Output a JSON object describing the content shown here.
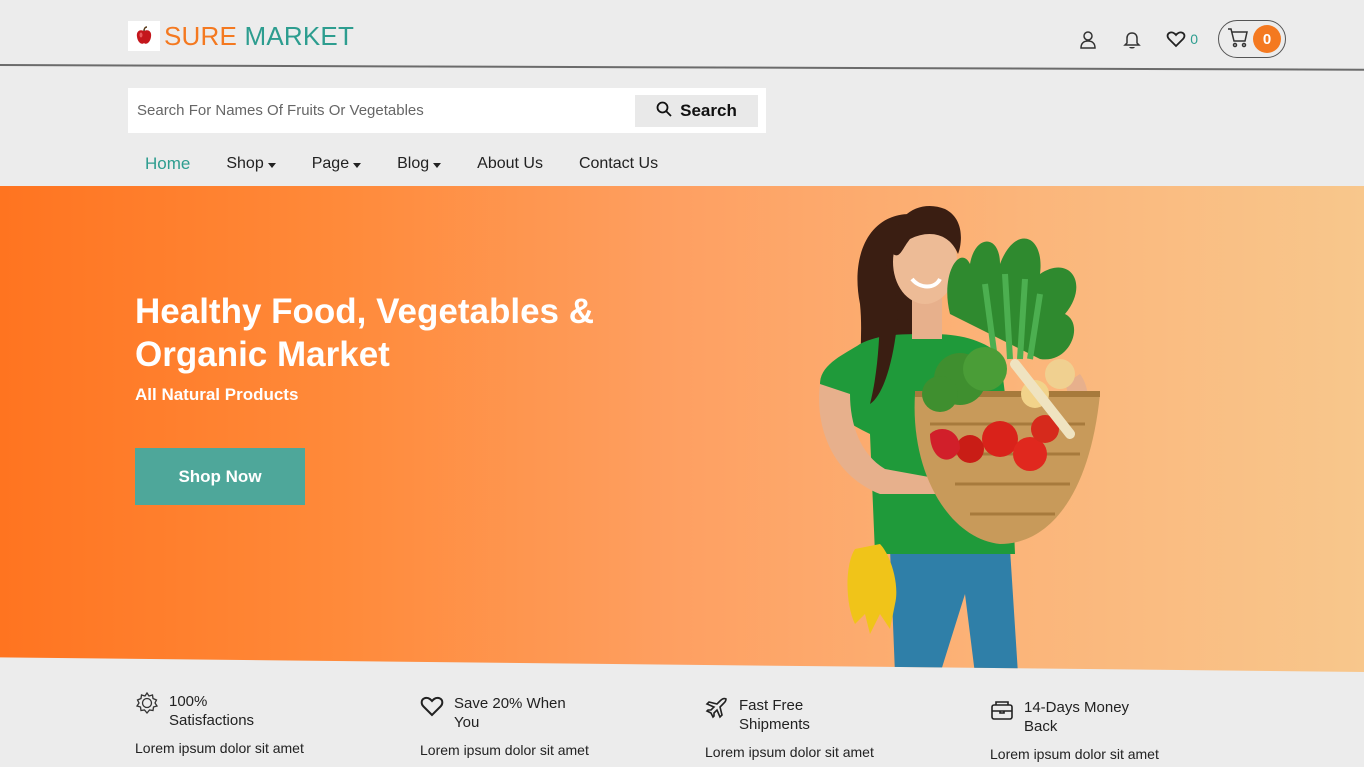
{
  "logo": {
    "sure": "SURE",
    "market": "MARKET"
  },
  "header": {
    "wishlist_count": "0",
    "cart_count": "0"
  },
  "search": {
    "placeholder": "Search For Names Of Fruits Or Vegetables",
    "button_label": "Search"
  },
  "nav": {
    "items": [
      {
        "label": "Home"
      },
      {
        "label": "Shop"
      },
      {
        "label": "Page"
      },
      {
        "label": "Blog"
      },
      {
        "label": "About Us"
      },
      {
        "label": "Contact Us"
      }
    ]
  },
  "hero": {
    "title": "Healthy Food, Vegetables & Organic Market",
    "subtitle": "All Natural Products",
    "cta": "Shop Now"
  },
  "features": [
    {
      "title": "100% Satisfactions",
      "desc": "Lorem ipsum dolor sit amet",
      "icon": "badge-icon"
    },
    {
      "title": "Save 20% When You",
      "desc": "Lorem ipsum dolor sit amet",
      "icon": "heart-icon"
    },
    {
      "title": "Fast Free Shipments",
      "desc": "Lorem ipsum dolor sit amet",
      "icon": "plane-icon"
    },
    {
      "title": "14-Days Money Back",
      "desc": "Lorem ipsum dolor sit amet",
      "icon": "wallet-icon"
    }
  ],
  "colors": {
    "orange": "#f47920",
    "teal": "#2d9d8f",
    "button_teal": "#4ea79a"
  }
}
